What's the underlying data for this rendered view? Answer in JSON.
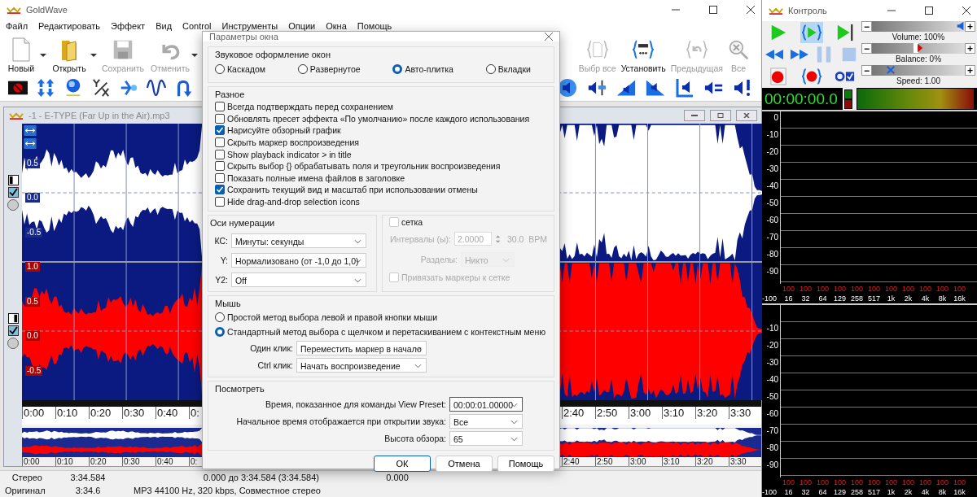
{
  "app": {
    "title": "GoldWave",
    "menu": [
      "Файл",
      "Редактировать",
      "Эффект",
      "Вид",
      "Control",
      "Инструменты",
      "Опции",
      "Окна",
      "Помощь"
    ]
  },
  "toolbar": {
    "left": [
      {
        "label": "Новый",
        "kind": "new",
        "disabled": false,
        "menu": true
      },
      {
        "label": "Открыть",
        "kind": "open",
        "disabled": false,
        "menu": true
      },
      {
        "label": "Сохранить",
        "kind": "save",
        "disabled": true,
        "menu": false
      },
      {
        "label": "Отменить",
        "kind": "undo",
        "disabled": true,
        "menu": true
      }
    ],
    "right": [
      {
        "label": "Выбр все",
        "kind": "select",
        "disabled": true,
        "menu": false
      },
      {
        "label": "Установить",
        "kind": "set",
        "disabled": false,
        "menu": false
      },
      {
        "label": "Предыдущая",
        "kind": "previous",
        "disabled": true,
        "menu": false
      },
      {
        "label": "Все",
        "kind": "zoom",
        "disabled": true,
        "menu": false
      }
    ]
  },
  "document": {
    "title": "-1 - E-TYPE (Far Up in the Air).mp3",
    "channels": [
      {
        "enabled": true,
        "color": "#ffffff",
        "labels": [
          "0.5",
          "0.0",
          "-0.5"
        ]
      },
      {
        "enabled": true,
        "color": "#ff0000",
        "labels": [
          "1.0",
          "0.5",
          "0.0",
          "-0.5"
        ]
      }
    ],
    "ruler": [
      "0:00",
      "0:10",
      "0:20",
      "0:30",
      "0:40",
      "0:"
    ],
    "ruler_end": [
      "2:40",
      "2:50",
      "3:00",
      "3:10",
      "3:20",
      "3:30"
    ],
    "overview_ruler": [
      "0:00",
      "0:10",
      "0:20",
      "0:30",
      "0:40",
      "0:"
    ],
    "overview_ruler_end": [
      "2:40",
      "2:50",
      "3:00",
      "3:10",
      "3:20",
      "3:30"
    ]
  },
  "status_bar": [
    [
      "Стерео",
      "3:34.584",
      "0.000 до 3:34.584 (3:34.584)",
      "0.000"
    ],
    [
      "Оригинал",
      "3:34.6",
      "MP3 44100 Hz, 320 kbps, Совместное стерео"
    ]
  ],
  "dialog": {
    "title": "Параметры окна",
    "layout": {
      "legend": "Звуковое оформление окон",
      "options": [
        {
          "label": "Каскадом",
          "selected": false
        },
        {
          "label": "Развернутое",
          "selected": false
        },
        {
          "label": "Авто-плитка",
          "selected": true
        },
        {
          "label": "Вкладки",
          "selected": false
        }
      ]
    },
    "misc": {
      "legend": "Разное",
      "options": [
        {
          "label": "Всегда подтверждать перед сохранением",
          "checked": false
        },
        {
          "label": "Обновлять пресет эффекта «По умолчанию» после каждого использования",
          "checked": false
        },
        {
          "label": "Нарисуйте обзорный график",
          "checked": true
        },
        {
          "label": "Скрыть маркер воспроизведения",
          "checked": false
        },
        {
          "label": "Show playback indicator > in title",
          "checked": false
        },
        {
          "label": "Скрыть выбор {} обрабатывать поля и треугольник воспроизведения",
          "checked": false
        },
        {
          "label": "Показать полные имена файлов в заголовке",
          "checked": false
        },
        {
          "label": "Сохранить текущий вид и масштаб при использовании отмены",
          "checked": true
        },
        {
          "label": "Hide drag-and-drop selection icons",
          "checked": false
        }
      ]
    },
    "axes": {
      "legend": "Оси нумерации",
      "fields": [
        {
          "label": "КС:",
          "value": "Минуты: секунды"
        },
        {
          "label": "Y:",
          "value": "Нормализовано (от -1,0 до 1,0)"
        },
        {
          "label": "Y2:",
          "value": "Off"
        }
      ]
    },
    "grid": {
      "label": "сетка",
      "checked": false,
      "interval_label": "Интервалы (ы):",
      "interval": "2.0000",
      "bpm": "30.0  BPM",
      "sections_label": "Разделы:",
      "sections": "Никто",
      "snap_label": "Привязать маркеры к сетке",
      "snap_checked": false
    },
    "mouse": {
      "legend": "Мышь",
      "options": [
        {
          "label": "Простой метод выбора левой и правой кнопки мыши",
          "selected": false
        },
        {
          "label": "Стандартный метод выбора с щелчком и перетаскиванием с контекстным меню",
          "selected": true
        }
      ],
      "fields": [
        {
          "label": "Один клик:",
          "value": "Переместить маркер в начало"
        },
        {
          "label": "Ctrl клик:",
          "value": "Начать воспроизведение"
        }
      ]
    },
    "view": {
      "legend": "Посмотреть",
      "fields": [
        {
          "label": "Время, показанное для команды View Preset:",
          "value": "00:00:01.00000"
        },
        {
          "label": "Начальное время отображается при открытии звука:",
          "value": "Все"
        },
        {
          "label": "Высота обзора:",
          "value": "65"
        }
      ]
    },
    "buttons": [
      {
        "label": "ОК",
        "default": true
      },
      {
        "label": "Отмена",
        "default": false
      },
      {
        "label": "Помощь",
        "default": false
      }
    ]
  },
  "control": {
    "title": "Контроль",
    "transport": [
      [
        {
          "kind": "play",
          "disabled": false
        },
        {
          "kind": "play-selection",
          "disabled": false
        },
        {
          "kind": "play-end",
          "disabled": false
        }
      ],
      [
        {
          "kind": "rewind",
          "disabled": false
        },
        {
          "kind": "forward",
          "disabled": false
        },
        {
          "kind": "pause",
          "disabled": true
        },
        {
          "kind": "stop",
          "disabled": true
        }
      ],
      [
        {
          "kind": "record",
          "disabled": false
        },
        {
          "kind": "record-selection",
          "disabled": false
        },
        {
          "kind": "monitor",
          "disabled": false
        }
      ]
    ],
    "sliders": [
      {
        "kind": "volume",
        "label": "Volume: 100%",
        "level": 0.96,
        "dec": "−",
        "inc": "+"
      },
      {
        "kind": "balance",
        "label": "Balance: 0%",
        "level": 0.5,
        "dec": "−",
        "inc": "+"
      },
      {
        "kind": "speed",
        "label": "Speed: 1.00",
        "level": 0.2,
        "dec": "−",
        "inc": "+"
      }
    ],
    "time": "00:00:00.0",
    "spectra": [
      {
        "labels": [
          "0",
          "-10",
          "-20",
          "-30",
          "-40",
          "-50",
          "-60",
          "-70",
          "-80",
          "-90"
        ],
        "peaks": [
          "100",
          "100",
          "100",
          "100",
          "100",
          "100",
          "100",
          "100",
          "100",
          "100",
          "100"
        ],
        "floor": "-100",
        "freqs": [
          "16",
          "32",
          "64",
          "129",
          "258",
          "517",
          "1k",
          "2k",
          "4k",
          "8k",
          "16k"
        ]
      },
      {
        "labels": [
          "-10",
          "-20",
          "-30",
          "-40",
          "-50",
          "-60",
          "-70",
          "-80",
          "-90"
        ],
        "peaks": [
          "100",
          "100",
          "100",
          "100",
          "100",
          "100",
          "100",
          "100",
          "100",
          "100",
          "100"
        ],
        "floor": "-100",
        "freqs": [
          "16",
          "32",
          "64",
          "129",
          "258",
          "517",
          "1k",
          "2k",
          "4k",
          "8k",
          "16k"
        ]
      }
    ]
  }
}
